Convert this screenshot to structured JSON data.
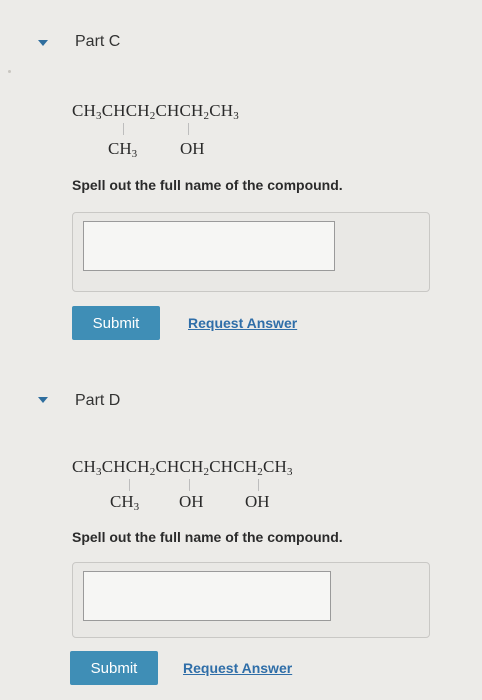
{
  "partC": {
    "title": "Part C",
    "formula_main": "CH3CHCH2CHCH2CH3",
    "branch1": "CH3",
    "branch2": "OH",
    "prompt": "Spell out the full name of the compound.",
    "answer_value": "",
    "submit_label": "Submit",
    "request_label": "Request Answer"
  },
  "partD": {
    "title": "Part D",
    "formula_main": "CH3CHCH2CHCH2CHCH2CH3",
    "branch1": "CH3",
    "branch2": "OH",
    "branch3": "OH",
    "prompt": "Spell out the full name of the compound.",
    "answer_value": "",
    "submit_label": "Submit",
    "request_label": "Request Answer"
  },
  "colors": {
    "accent": "#3f8eb6",
    "link": "#2f6ea8",
    "toggle": "#2f6e9e",
    "background": "#ecebe8"
  },
  "icons": {
    "collapse": "triangle-down-icon"
  }
}
